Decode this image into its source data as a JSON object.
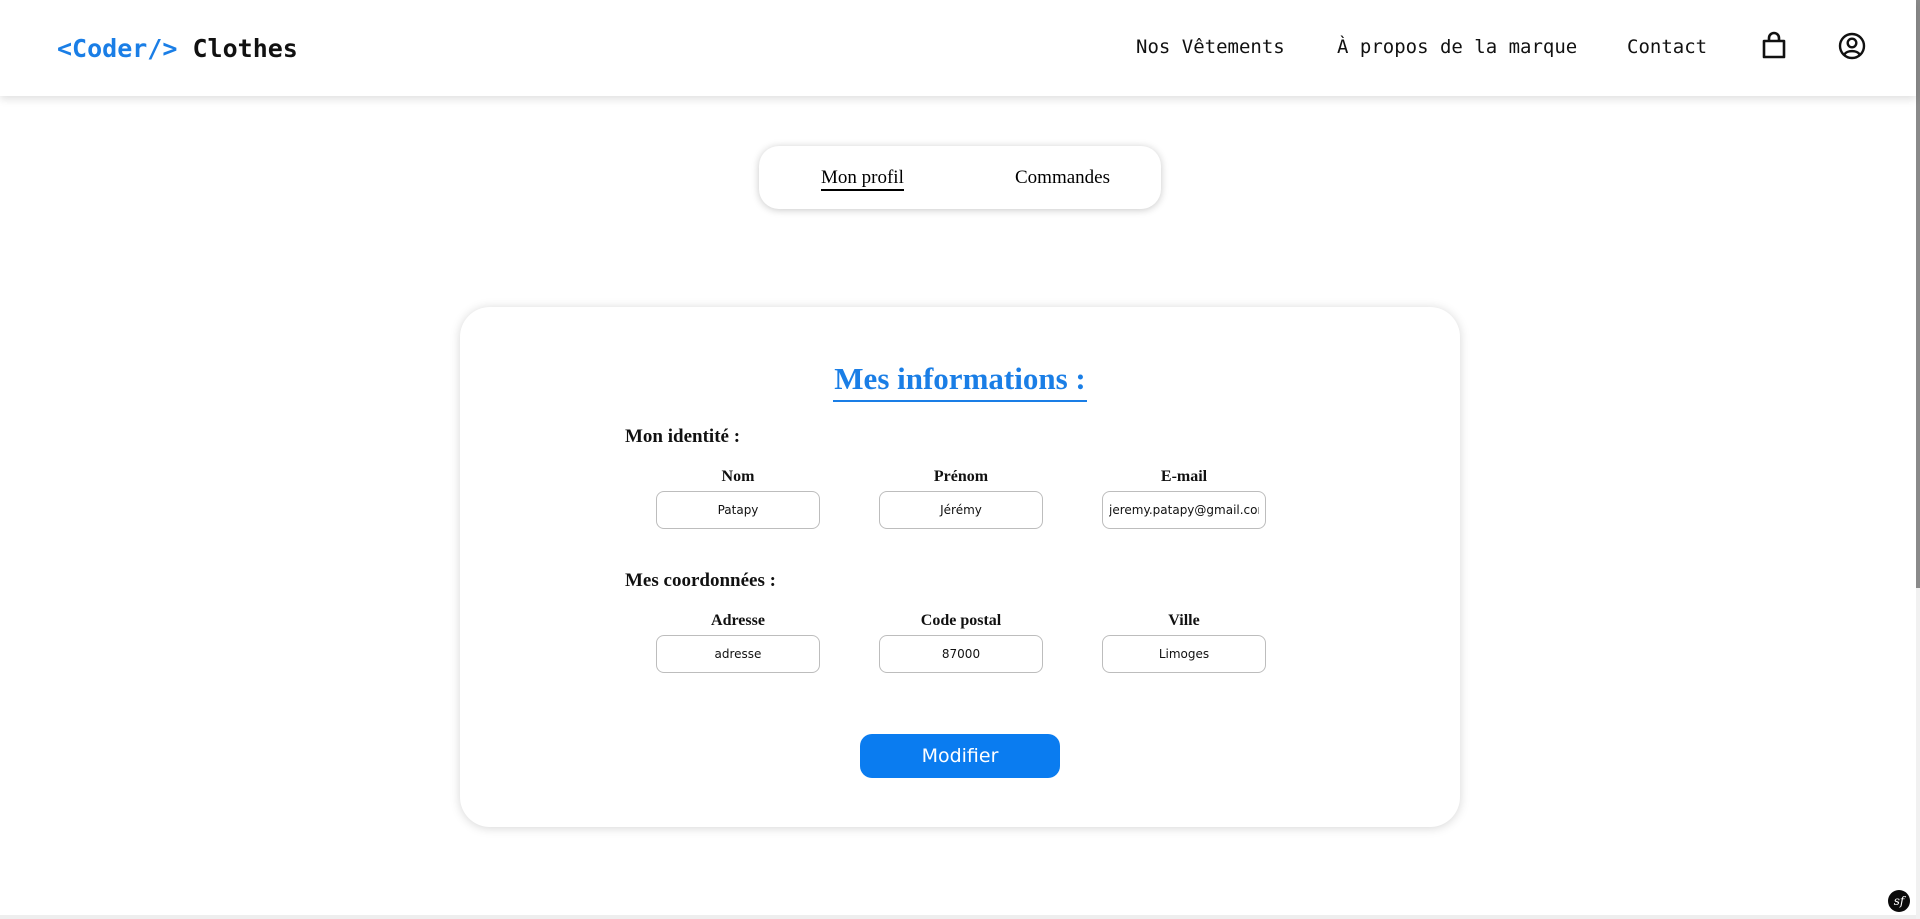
{
  "header": {
    "logo_tag": "<Coder/>",
    "logo_brand": "Clothes",
    "nav": {
      "clothes": "Nos Vêtements",
      "about": "À propos de la marque",
      "contact": "Contact"
    },
    "icons": {
      "cart": "shopping-bag-icon",
      "account": "user-circle-icon"
    }
  },
  "tabs": {
    "profile": "Mon profil",
    "orders": "Commandes",
    "active": "profile"
  },
  "card": {
    "title": "Mes informations :",
    "identity": {
      "title": "Mon identité :",
      "last_name_label": "Nom",
      "last_name_value": "Patapy",
      "first_name_label": "Prénom",
      "first_name_value": "Jérémy",
      "email_label": "E-mail",
      "email_value": "jeremy.patapy@gmail.com"
    },
    "contact": {
      "title": "Mes coordonnées :",
      "address_label": "Adresse",
      "address_value": "adresse",
      "zip_label": "Code postal",
      "zip_value": "87000",
      "city_label": "Ville",
      "city_value": "Limoges"
    },
    "submit_label": "Modifier"
  },
  "debug_toolbar": {
    "badge": "sf"
  },
  "colors": {
    "accent": "#1a7ee6",
    "button": "#0a7cf0"
  }
}
